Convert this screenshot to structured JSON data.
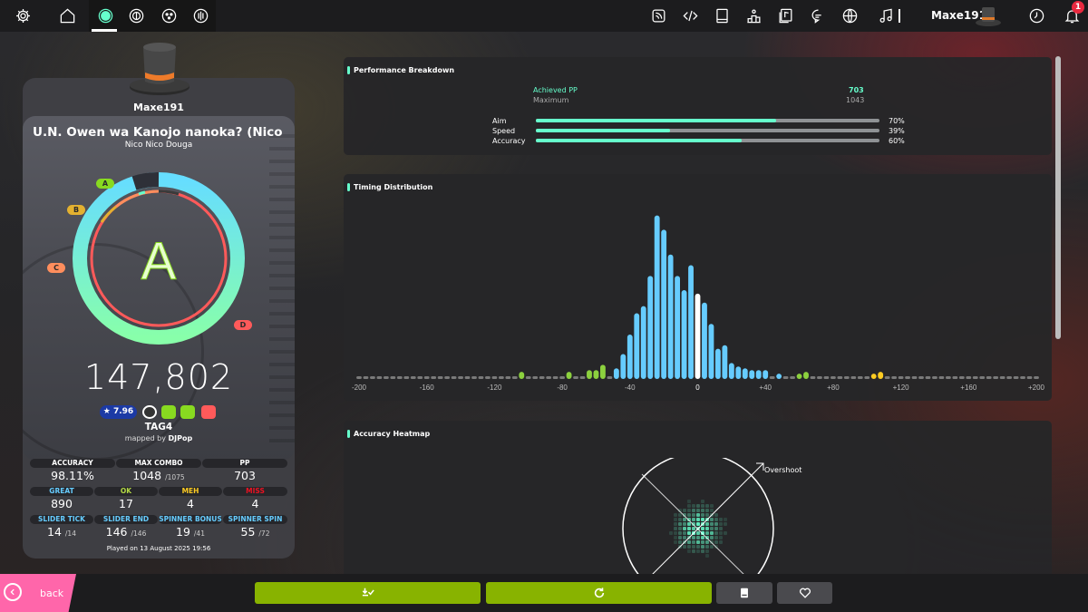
{
  "toolbar": {
    "left_icons": [
      "settings-icon",
      "home-icon",
      "osu-ruleset-icon",
      "taiko-ruleset-icon",
      "catch-ruleset-icon",
      "mania-ruleset-icon"
    ],
    "right_icons": [
      "news-icon",
      "changelog-icon",
      "wiki-icon",
      "rankings-icon",
      "beatmap-listing-icon",
      "chat-icon",
      "dashboard-icon",
      "music-icon",
      "clock-icon",
      "notifications-icon"
    ],
    "username": "Maxe191",
    "notification_count": "1"
  },
  "score_card": {
    "username": "Maxe191",
    "title": "U.N. Owen wa Kanojo nanoka? (Nico Mega...",
    "artist": "Nico Nico Douga",
    "rank": "A",
    "rank_labels": [
      "A",
      "B",
      "C",
      "D"
    ],
    "accuracy_fraction": 0.9811,
    "score": "147,802",
    "star_rating": "★ 7.96",
    "difficulty": "TAG4",
    "mapped_by_label": "mapped by",
    "mapper": "DJPop",
    "stats_row1": [
      {
        "label": "ACCURACY",
        "value": "98.11%",
        "suffix": "",
        "color": "#ffffff"
      },
      {
        "label": "MAX COMBO",
        "value": "1048",
        "suffix": "/1075",
        "color": "#ffffff"
      },
      {
        "label": "PP",
        "value": "703",
        "suffix": "",
        "color": "#ffffff"
      }
    ],
    "stats_row2": [
      {
        "label": "GREAT",
        "value": "890",
        "color": "#66ccff"
      },
      {
        "label": "OK",
        "value": "17",
        "color": "#b3d944"
      },
      {
        "label": "MEH",
        "value": "4",
        "color": "#ffcc22"
      },
      {
        "label": "MISS",
        "value": "4",
        "color": "#ed1121"
      }
    ],
    "stats_row3": [
      {
        "label": "SLIDER TICK",
        "value": "14",
        "suffix": "/14",
        "color": "#66ccff"
      },
      {
        "label": "SLIDER END",
        "value": "146",
        "suffix": "/146",
        "color": "#66ccff"
      },
      {
        "label": "SPINNER BONUS",
        "value": "19",
        "suffix": "/41",
        "color": "#66ccff"
      },
      {
        "label": "SPINNER SPIN",
        "value": "55",
        "suffix": "/72",
        "color": "#66ccff"
      }
    ],
    "played_date": "Played on 13 August 2025 19:56"
  },
  "performance": {
    "title": "Performance Breakdown",
    "achieved_label": "Achieved PP",
    "achieved_value": "703",
    "maximum_label": "Maximum",
    "maximum_value": "1043",
    "bars": [
      {
        "label": "Aim",
        "value": 0.7,
        "text": "70%"
      },
      {
        "label": "Speed",
        "value": 0.39,
        "text": "39%"
      },
      {
        "label": "Accuracy",
        "value": 0.6,
        "text": "60%"
      }
    ]
  },
  "timing": {
    "title": "Timing Distribution"
  },
  "heatmap": {
    "title": "Accuracy Heatmap",
    "overshoot_label": "Overshoot"
  },
  "chart_data": {
    "type": "bar",
    "title": "Timing Distribution",
    "xlabel": "",
    "ylabel": "",
    "x_ticks": [
      "-200",
      "-160",
      "-120",
      "-80",
      "-40",
      "0",
      "+40",
      "+80",
      "+120",
      "+160",
      "+200"
    ],
    "xlim": [
      -200,
      200
    ],
    "bin_width": 4,
    "bins": [
      {
        "x": -104,
        "v": 0.04,
        "c": "#8cd13e"
      },
      {
        "x": -76,
        "v": 0.04,
        "c": "#8cd13e"
      },
      {
        "x": -66,
        "v": 0.03,
        "c": "#8cd13e"
      },
      {
        "x": -64,
        "v": 0.05,
        "c": "#8cd13e"
      },
      {
        "x": -60,
        "v": 0.05,
        "c": "#8cd13e"
      },
      {
        "x": -58,
        "v": 0.06,
        "c": "#8cd13e"
      },
      {
        "x": -56,
        "v": 0.08,
        "c": "#8cd13e"
      },
      {
        "x": -54,
        "v": 0.06,
        "c": "#8cd13e"
      },
      {
        "x": -50,
        "v": 0.04,
        "c": "#66ccff"
      },
      {
        "x": -48,
        "v": 0.06,
        "c": "#66ccff"
      },
      {
        "x": -46,
        "v": 0.08,
        "c": "#66ccff"
      },
      {
        "x": -44,
        "v": 0.14,
        "c": "#66ccff"
      },
      {
        "x": -42,
        "v": 0.17,
        "c": "#66ccff"
      },
      {
        "x": -40,
        "v": 0.25,
        "c": "#66ccff"
      },
      {
        "x": -38,
        "v": 0.27,
        "c": "#66ccff"
      },
      {
        "x": -36,
        "v": 0.37,
        "c": "#66ccff"
      },
      {
        "x": -34,
        "v": 0.39,
        "c": "#66ccff"
      },
      {
        "x": -32,
        "v": 0.41,
        "c": "#66ccff"
      },
      {
        "x": -30,
        "v": 0.57,
        "c": "#66ccff"
      },
      {
        "x": -28,
        "v": 0.58,
        "c": "#66ccff"
      },
      {
        "x": -26,
        "v": 0.77,
        "c": "#66ccff"
      },
      {
        "x": -24,
        "v": 0.92,
        "c": "#66ccff"
      },
      {
        "x": -22,
        "v": 1.0,
        "c": "#66ccff"
      },
      {
        "x": -20,
        "v": 0.84,
        "c": "#66ccff"
      },
      {
        "x": -18,
        "v": 0.65,
        "c": "#66ccff"
      },
      {
        "x": -16,
        "v": 0.7,
        "c": "#66ccff"
      },
      {
        "x": -14,
        "v": 0.6,
        "c": "#66ccff"
      },
      {
        "x": -12,
        "v": 0.58,
        "c": "#66ccff"
      },
      {
        "x": -10,
        "v": 0.56,
        "c": "#66ccff"
      },
      {
        "x": -8,
        "v": 0.5,
        "c": "#66ccff"
      },
      {
        "x": -6,
        "v": 0.46,
        "c": "#66ccff"
      },
      {
        "x": -4,
        "v": 0.64,
        "c": "#66ccff"
      },
      {
        "x": -2,
        "v": 0.49,
        "c": "#66ccff"
      },
      {
        "x": 0,
        "v": 0.48,
        "c": "#ffffff"
      },
      {
        "x": 2,
        "v": 0.45,
        "c": "#66ccff"
      },
      {
        "x": 4,
        "v": 0.43,
        "c": "#66ccff"
      },
      {
        "x": 6,
        "v": 0.38,
        "c": "#66ccff"
      },
      {
        "x": 8,
        "v": 0.31,
        "c": "#66ccff"
      },
      {
        "x": 10,
        "v": 0.26,
        "c": "#66ccff"
      },
      {
        "x": 12,
        "v": 0.17,
        "c": "#66ccff"
      },
      {
        "x": 14,
        "v": 0.19,
        "c": "#66ccff"
      },
      {
        "x": 16,
        "v": 0.19,
        "c": "#66ccff"
      },
      {
        "x": 18,
        "v": 0.14,
        "c": "#66ccff"
      },
      {
        "x": 20,
        "v": 0.09,
        "c": "#66ccff"
      },
      {
        "x": 22,
        "v": 0.07,
        "c": "#66ccff"
      },
      {
        "x": 24,
        "v": 0.07,
        "c": "#66ccff"
      },
      {
        "x": 26,
        "v": 0.05,
        "c": "#66ccff"
      },
      {
        "x": 28,
        "v": 0.06,
        "c": "#66ccff"
      },
      {
        "x": 30,
        "v": 0.07,
        "c": "#66ccff"
      },
      {
        "x": 32,
        "v": 0.05,
        "c": "#66ccff"
      },
      {
        "x": 34,
        "v": 0.04,
        "c": "#66ccff"
      },
      {
        "x": 36,
        "v": 0.05,
        "c": "#66ccff"
      },
      {
        "x": 38,
        "v": 0.06,
        "c": "#66ccff"
      },
      {
        "x": 40,
        "v": 0.05,
        "c": "#66ccff"
      },
      {
        "x": 42,
        "v": 0.04,
        "c": "#66ccff"
      },
      {
        "x": 48,
        "v": 0.03,
        "c": "#66ccff"
      },
      {
        "x": 50,
        "v": 0.03,
        "c": "#8cd13e"
      },
      {
        "x": 60,
        "v": 0.03,
        "c": "#8cd13e"
      },
      {
        "x": 64,
        "v": 0.04,
        "c": "#8cd13e"
      },
      {
        "x": 86,
        "v": 0.04,
        "c": "#8cd13e"
      },
      {
        "x": 104,
        "v": 0.03,
        "c": "#ffcc22"
      },
      {
        "x": 108,
        "v": 0.04,
        "c": "#ffcc22"
      },
      {
        "x": 110,
        "v": 0.04,
        "c": "#ffcc22"
      },
      {
        "x": 114,
        "v": 0.03,
        "c": "#ffcc22"
      },
      {
        "x": 150,
        "v": 0.03,
        "c": "#ffcc22"
      }
    ]
  },
  "bottom_bar": {
    "back_label": "back",
    "buttons": [
      "export-button",
      "retry-button",
      "beatmap-info-button",
      "favourite-button"
    ]
  },
  "colors": {
    "accent": "#66ffcc",
    "great": "#66ccff",
    "ok": "#b3d944",
    "meh": "#ffcc22",
    "miss": "#ed1121",
    "back": "#ff66aa",
    "action": "#88b300",
    "rank_a": "#88da20",
    "rank_b": "#e3b130",
    "rank_c": "#ff8e5d",
    "rank_d": "#ff5a5a"
  }
}
